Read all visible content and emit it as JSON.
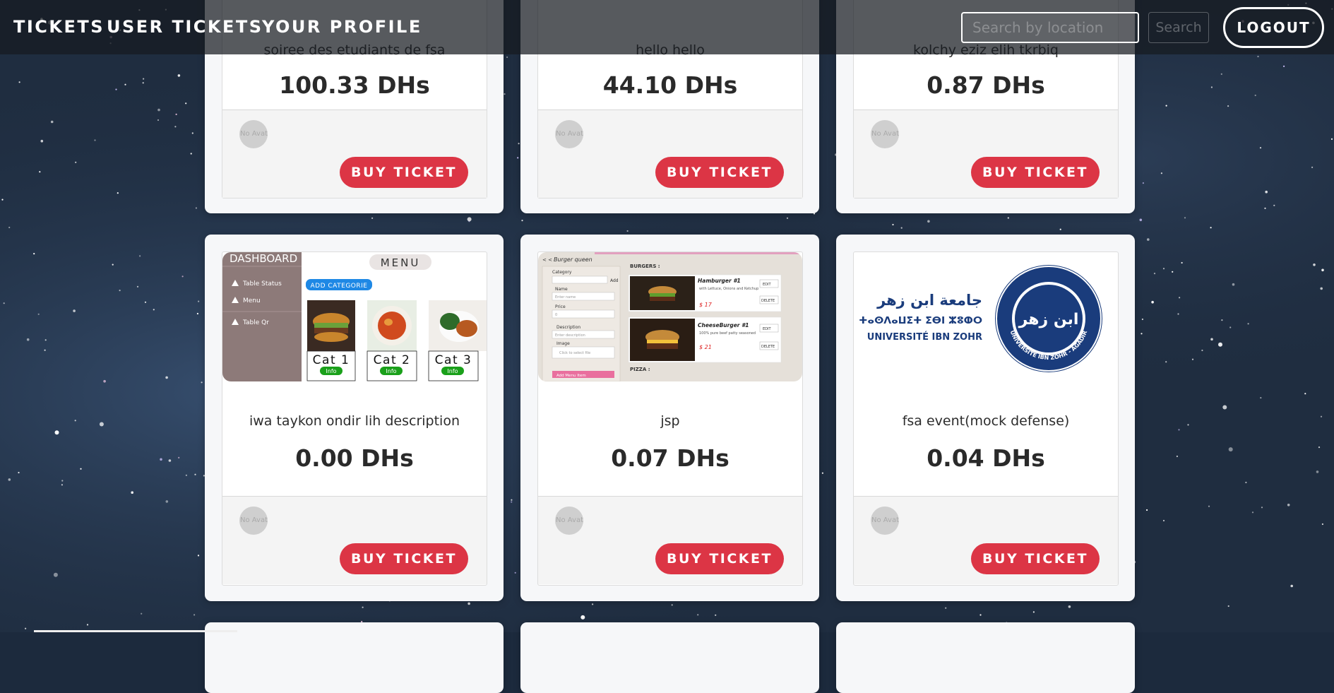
{
  "navbar": {
    "links": [
      "TICKETS",
      "USER TICKETS",
      "YOUR PROFILE"
    ],
    "search_placeholder": "Search by location",
    "search_button": "Search",
    "logout": "LOGOUT"
  },
  "events": [
    {
      "title": "soiree des etudiants de fsa",
      "price": "100.33 DHs",
      "avatar_alt": "No Avatar",
      "buy": "BUY TICKET"
    },
    {
      "title": "hello hello",
      "price": "44.10 DHs",
      "avatar_alt": "No Avatar",
      "buy": "BUY TICKET"
    },
    {
      "title": "kolchy eziz elih tkrbiq",
      "price": "0.87 DHs",
      "avatar_alt": "No Avatar",
      "buy": "BUY TICKET"
    },
    {
      "title": "iwa taykon ondir lih description",
      "price": "0.00 DHs",
      "avatar_alt": "No Avatar",
      "buy": "BUY TICKET"
    },
    {
      "title": "jsp",
      "price": "0.07 DHs",
      "avatar_alt": "No Avatar",
      "buy": "BUY TICKET"
    },
    {
      "title": "fsa event(mock defense)",
      "price": "0.04 DHs",
      "avatar_alt": "No Avatar",
      "buy": "BUY TICKET"
    }
  ],
  "thumb_dashboard": {
    "sidebar_title": "DASHBOARD",
    "sidebar_items": [
      "Table Status",
      "Menu",
      "Table Qr"
    ],
    "menu_title": "MENU",
    "add_category": "ADD CATEGORIE",
    "categories": [
      "Cat 1",
      "Cat 2",
      "Cat 3"
    ],
    "info": "Info"
  },
  "thumb_burger": {
    "app_name": "Burger queen",
    "nav": "< <",
    "form_category": "Category",
    "form_add": "Add",
    "form_name": "Name",
    "form_name_placeholder": "Enter name",
    "form_price": "Price",
    "form_price_value": "0",
    "form_description": "Description",
    "form_description_placeholder": "Enter description",
    "form_image": "Image",
    "form_image_placeholder": "Click to select file",
    "form_submit": "Add Menu Item",
    "section_burgers": "BURGERS :",
    "section_pizza": "PIZZA :",
    "items": [
      {
        "name": "Hamburger #1",
        "desc": "with Lettuce, Onions and Ketchup",
        "price": "$ 17"
      },
      {
        "name": "CheeseBurger #1",
        "desc": "100% pure beef patty seasoned",
        "price": "$ 21"
      }
    ],
    "edit": "EDIT",
    "delete": "DELETE"
  },
  "thumb_university": {
    "name_arabic": "جامعة ابن زهر",
    "name_tifinagh": "ⵜⴰⵙⴷⴰⵡⵉⵜ ⵉⴱⵏ ⵣⵓⵀⵔ",
    "name_latin": "UNIVERSITÉ IBN ZOHR",
    "seal_text": "UNIVERSITÉ IBN ZOHR - AGADIR",
    "seal_center": "ابن زهر"
  },
  "colors": {
    "accent": "#dc3545",
    "card_bg": "#f6f7f9",
    "navbar_bg": "#161a20"
  },
  "icons": {
    "avatar": "user-avatar-placeholder",
    "triangle": "triangle-bullet-icon"
  }
}
